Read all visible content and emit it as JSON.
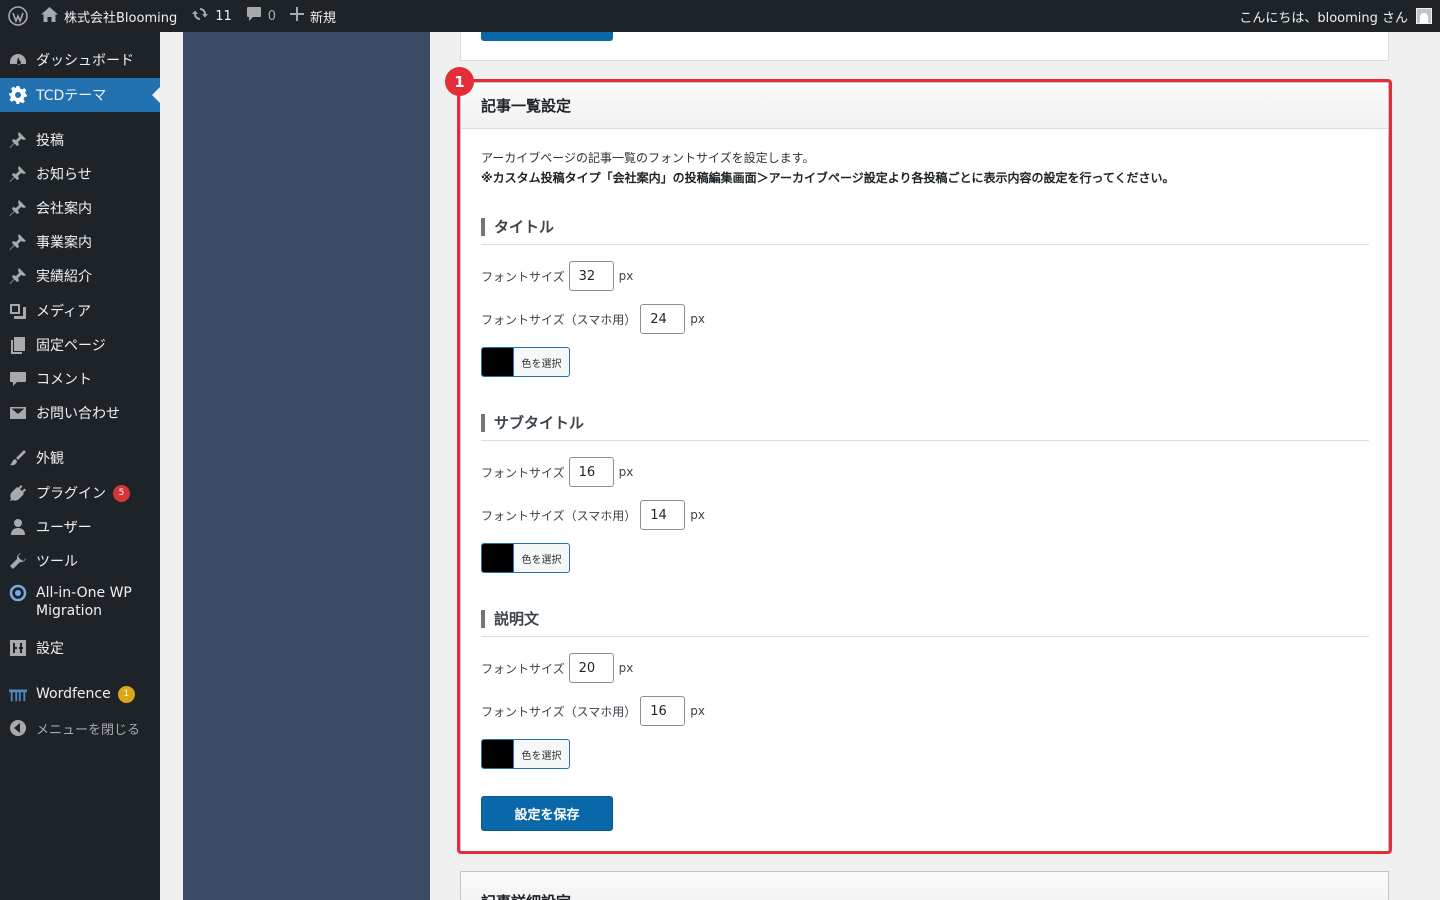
{
  "adminbar": {
    "site_name": "株式会社Blooming",
    "updates_count": "11",
    "comments_count": "0",
    "new_label": "新規",
    "greeting": "こんにちは、blooming さん"
  },
  "sidebar": {
    "items": [
      {
        "label": "ダッシュボード",
        "icon": "dashboard-icon"
      },
      {
        "label": "TCDテーマ",
        "icon": "gear-icon",
        "active": true
      },
      {
        "label": "投稿",
        "icon": "pin-icon"
      },
      {
        "label": "お知らせ",
        "icon": "pin-icon"
      },
      {
        "label": "会社案内",
        "icon": "pin-icon"
      },
      {
        "label": "事業案内",
        "icon": "pin-icon"
      },
      {
        "label": "実績紹介",
        "icon": "pin-icon"
      },
      {
        "label": "メディア",
        "icon": "media-icon"
      },
      {
        "label": "固定ページ",
        "icon": "page-icon"
      },
      {
        "label": "コメント",
        "icon": "comment-icon"
      },
      {
        "label": "お問い合わせ",
        "icon": "mail-icon"
      },
      {
        "label": "外観",
        "icon": "brush-icon"
      },
      {
        "label": "プラグイン",
        "icon": "plugin-icon",
        "badge": "5"
      },
      {
        "label": "ユーザー",
        "icon": "user-icon"
      },
      {
        "label": "ツール",
        "icon": "wrench-icon"
      },
      {
        "label": "All-in-One WP",
        "label2": "Migration",
        "icon": "migration-icon"
      },
      {
        "label": "設定",
        "icon": "settings-icon"
      },
      {
        "label": "Wordfence",
        "icon": "wordfence-icon",
        "badge": "1"
      },
      {
        "label": "メニューを閉じる",
        "icon": "collapse-icon"
      }
    ]
  },
  "panel": {
    "marker": "1",
    "title": "記事一覧設定",
    "description": "アーカイブページの記事一覧のフォントサイズを設定します。",
    "note": "※カスタム投稿タイプ「会社案内」の投稿編集画面＞アーカイブページ設定より各投稿ごとに表示内容の設定を行ってください。",
    "font_size_label": "フォントサイズ",
    "font_size_sp_label": "フォントサイズ（スマホ用）",
    "unit": "px",
    "color_button_label": "色を選択",
    "color_value": "#000000",
    "sections": [
      {
        "title": "タイトル",
        "font_size": "32",
        "font_size_sp": "24"
      },
      {
        "title": "サブタイトル",
        "font_size": "16",
        "font_size_sp": "14"
      },
      {
        "title": "説明文",
        "font_size": "20",
        "font_size_sp": "16"
      }
    ],
    "save_label": "設定を保存"
  },
  "next_panel": {
    "title": "記事詳細設定"
  },
  "colors": {
    "accent": "#2271b1",
    "highlight": "#e52d3a",
    "sidebar_bg": "#1d2327",
    "navy": "#3a4b66"
  }
}
